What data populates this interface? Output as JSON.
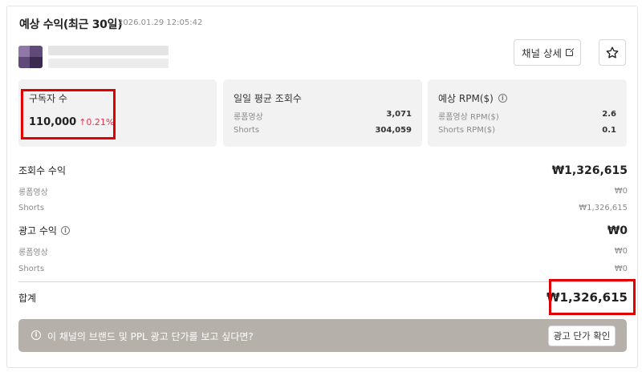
{
  "header": {
    "title": "예상 수익(최근 30일)",
    "timestamp": "2026.01.29 12:05:42"
  },
  "actions": {
    "detail_label": "채널 상세",
    "detail_icon": "external-link-icon",
    "favorite_icon": "star-outline-icon"
  },
  "cards": {
    "subscribers": {
      "title": "구독자 수",
      "value": "110,000",
      "change": "↑0.21%",
      "change_color": "#e0344e"
    },
    "daily_views": {
      "title": "일일 평균 조회수",
      "rows": [
        {
          "label": "롱폼영상",
          "value": "3,071"
        },
        {
          "label": "Shorts",
          "value": "304,059"
        }
      ]
    },
    "rpm": {
      "title": "예상 RPM($)",
      "rows": [
        {
          "label": "롱폼영상 RPM($)",
          "value": "2.6"
        },
        {
          "label": "Shorts RPM($)",
          "value": "0.1"
        }
      ]
    }
  },
  "revenue": {
    "views": {
      "label": "조회수 수익",
      "total": "₩1,326,615",
      "rows": [
        {
          "label": "롱폼영상",
          "value": "₩0"
        },
        {
          "label": "Shorts",
          "value": "₩1,326,615"
        }
      ]
    },
    "ads": {
      "label": "광고 수익",
      "total": "₩0",
      "rows": [
        {
          "label": "롱폼영상",
          "value": "₩0"
        },
        {
          "label": "Shorts",
          "value": "₩0"
        }
      ]
    },
    "sum": {
      "label": "합계",
      "value": "₩1,326,615"
    }
  },
  "promo": {
    "text": "이 채널의 브랜드 및 PPL 광고 단가를 보고 싶다면?",
    "button_label": "광고 단가 확인",
    "background": "#b5b0aa"
  },
  "colors": {
    "highlight": "#e10000",
    "card_bg": "#f2f2f3"
  }
}
